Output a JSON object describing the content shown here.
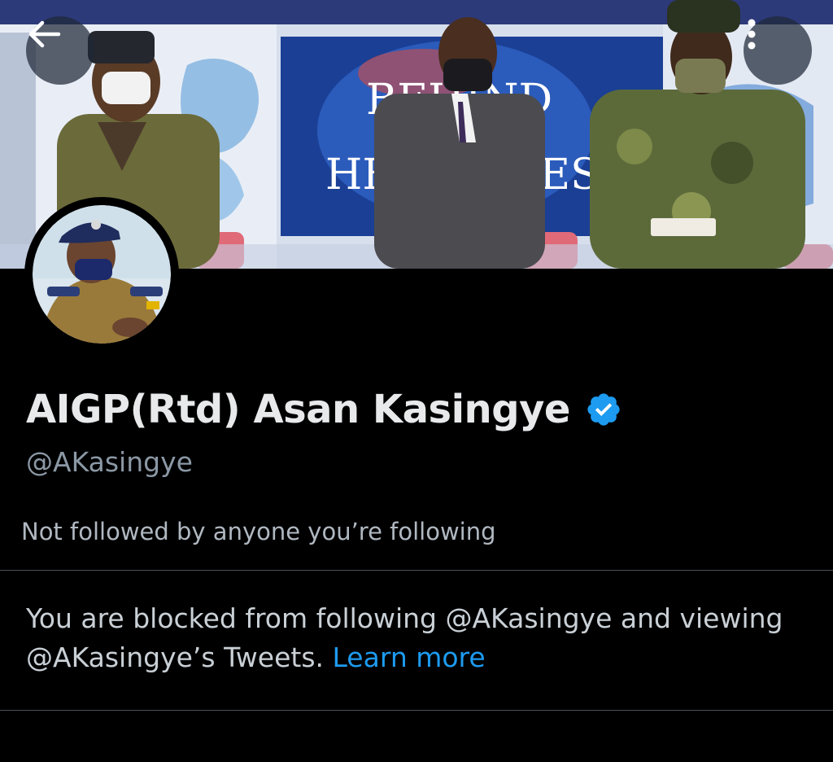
{
  "header": {
    "back_icon": "arrow-left-icon",
    "more_icon": "more-vertical-icon"
  },
  "banner": {
    "studio_text_top": "BEHIND",
    "studio_text_bottom": "HEADLINES"
  },
  "profile": {
    "display_name": "AIGP(Rtd) Asan Kasingye",
    "verified_icon": "verified-badge-icon",
    "handle": "@AKasingye",
    "followed_by": "Not followed by anyone you’re following"
  },
  "blocked": {
    "message": "You are blocked from following @AKasingye and viewing @AKasingye’s Tweets.",
    "link_label": "Learn more"
  },
  "colors": {
    "background": "#000000",
    "text_primary": "#e7e9ea",
    "text_secondary": "#8b98a5",
    "link": "#1d9bf0",
    "verified": "#1d9bf0"
  }
}
